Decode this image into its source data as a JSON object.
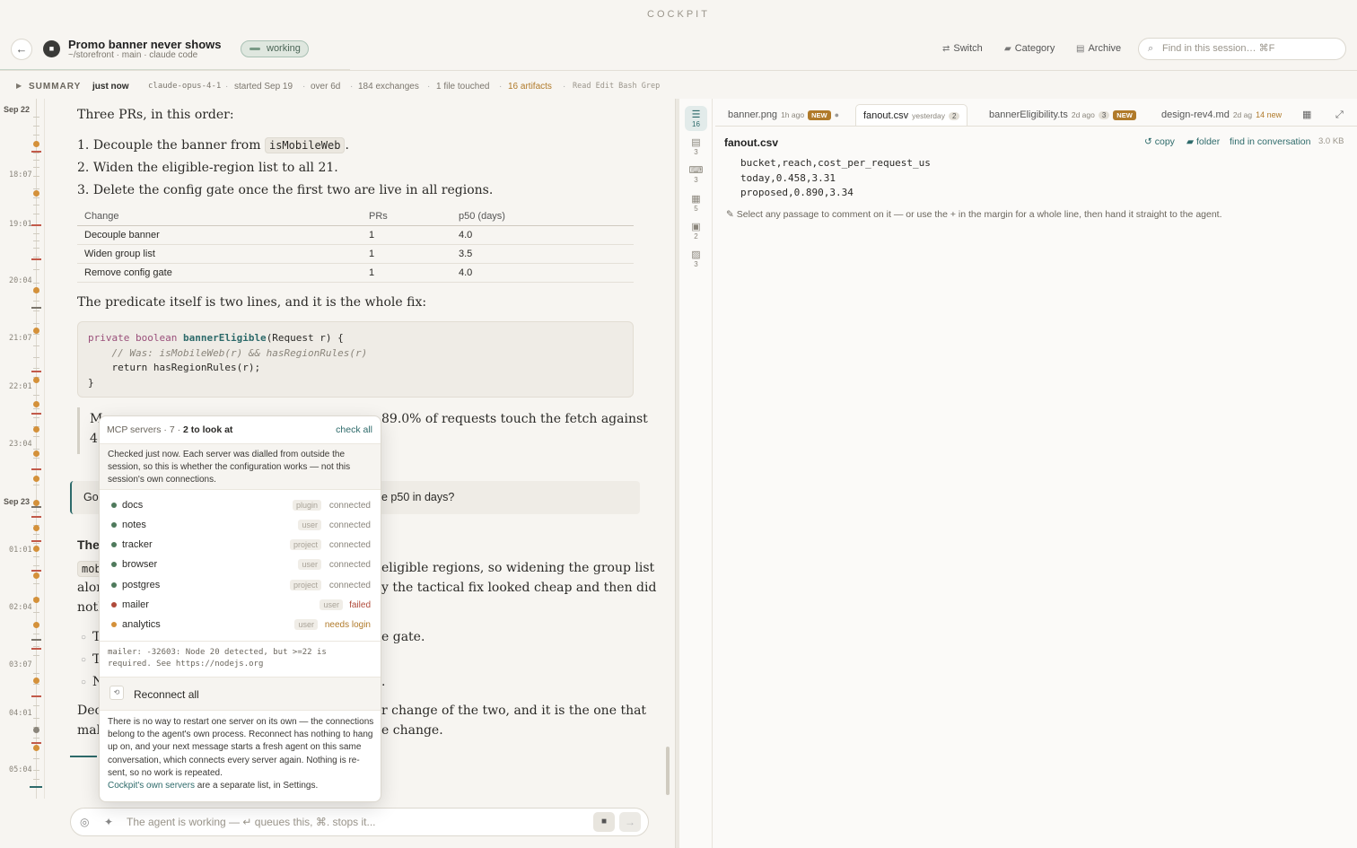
{
  "app": {
    "brand": "COCKPIT"
  },
  "header": {
    "title": "Promo banner never shows",
    "subtitle": "~/storefront · main · claude code",
    "status": "working",
    "switch": "Switch",
    "category": "Category",
    "archive": "Archive",
    "search_placeholder": "Find in this session…   ⌘F"
  },
  "summary": {
    "label": "SUMMARY",
    "when": "just now",
    "model": "claude-opus-4-1",
    "started": "started Sep 19",
    "duration": "over 6d",
    "exchanges": "184 exchanges",
    "files": "1 file touched",
    "artifacts": "16 artifacts",
    "tools": "Read Edit Bash Grep"
  },
  "timeline": {
    "labels": [
      "Sep 22",
      "18:07",
      "19:01",
      "20:04",
      "21:07",
      "22:01",
      "23:04",
      "Sep 23",
      "01:01",
      "02:04",
      "03:07",
      "04:01",
      "05:04"
    ]
  },
  "conversation": {
    "intro": "Three PRs, in this order:",
    "steps": [
      {
        "num": "1.",
        "pre": "Decouple the banner from ",
        "code": "isMobileWeb",
        "post": "."
      },
      {
        "num": "2.",
        "pre": "Widen the eligible-region list to all 21.",
        "code": "",
        "post": ""
      },
      {
        "num": "3.",
        "pre": "Delete the config gate once the first two are live in all regions.",
        "code": "",
        "post": ""
      }
    ],
    "table": {
      "headers": [
        "Change",
        "PRs",
        "p50 (days)"
      ],
      "rows": [
        [
          "Decouple banner",
          "1",
          "4.0"
        ],
        [
          "Widen group list",
          "1",
          "3.5"
        ],
        [
          "Remove config gate",
          "1",
          "4.0"
        ]
      ]
    },
    "predicate_text": "The predicate itself is two lines, and it is the whole fix:",
    "code": {
      "l1_kw1": "private",
      "l1_kw2": "boolean",
      "l1_fn": "bannerEligible",
      "l1_rest": "(Request r) {",
      "l2": "// Was: isMobileWeb(r) && hasRegionRules(r)",
      "l3": "return hasRegionRules(r);",
      "l4": "}"
    },
    "quote_l1_start": "M",
    "quote_l1_end": "89.0% of requests touch the fetch against",
    "quote_l2_start": "4!",
    "ask_start": "Go",
    "ask_end": "e p50 in days?",
    "heading_start": "The",
    "para1_code": "mob",
    "para1_end": "eligible regions, so widening the group list",
    "para2_start": "alor",
    "para2_end": "y the tactical fix looked cheap and then did",
    "para3_start": "noth",
    "bullets": [
      {
        "start": "T",
        "end": "e gate."
      },
      {
        "start": "T",
        "end": ""
      },
      {
        "start": "N",
        "end": "."
      }
    ],
    "closing1_start": "Dec",
    "closing1_end": "r change of the two, and it is the one that",
    "closing2_start": "mak",
    "closing2_end": "e change."
  },
  "composer": {
    "placeholder": "The agent is working — ↵ queues this, ⌘. stops it..."
  },
  "rail": {
    "counts": [
      "16",
      "3",
      "3",
      "5",
      "2",
      "3"
    ]
  },
  "tabs": [
    {
      "name": "banner.png",
      "ago": "1h ago",
      "badge": "NEW"
    },
    {
      "name": "fanout.csv",
      "ago": "yesterday",
      "badge": "2"
    },
    {
      "name": "bannerEligibility.ts",
      "ago": "2d ago",
      "badge": "3",
      "badge2": "NEW"
    },
    {
      "name": "design-rev4.md",
      "ago": "2d ag",
      "badge": "14 new"
    }
  ],
  "file": {
    "name": "fanout.csv",
    "copy": "copy",
    "folder": "folder",
    "find": "find in conversation",
    "size": "3.0 KB",
    "lines": [
      "bucket,reach,cost_per_request_us",
      "today,0.458,3.31",
      "proposed,0.890,3.34"
    ],
    "hint": "Select any passage to comment on it — or use the  +  in the margin for a whole line, then hand it straight to the agent."
  },
  "mcp": {
    "header_pre": "MCP servers · 7 · ",
    "header_bold": "2 to look at",
    "check_all": "check all",
    "description": "Checked just now. Each server was dialled from outside the session, so this is whether the configuration works — not this session's own connections.",
    "servers": [
      {
        "name": "docs",
        "scope": "plugin",
        "status": "connected"
      },
      {
        "name": "notes",
        "scope": "user",
        "status": "connected"
      },
      {
        "name": "tracker",
        "scope": "project",
        "status": "connected"
      },
      {
        "name": "browser",
        "scope": "user",
        "status": "connected"
      },
      {
        "name": "postgres",
        "scope": "project",
        "status": "connected"
      },
      {
        "name": "mailer",
        "scope": "user",
        "status": "failed"
      },
      {
        "name": "analytics",
        "scope": "user",
        "status": "needs login"
      }
    ],
    "error": "mailer: -32603: Node 20 detected, but >=22 is\nrequired. See https://nodejs.org",
    "reconnect": "Reconnect all",
    "footer": "There is no way to restart one server on its own — the connections belong to the agent's own process. Reconnect has nothing to hang up on, and your next message starts a fresh agent on this same conversation, which connects every server again. Nothing is re-sent, so no work is repeated.",
    "footer_link": "Cockpit's own servers",
    "footer_end": " are a separate list, in Settings."
  },
  "colors": {
    "accent": "#2d6a6a",
    "warn": "#b07a2a",
    "fail": "#b04a3a",
    "ok": "#4f7a5c"
  }
}
